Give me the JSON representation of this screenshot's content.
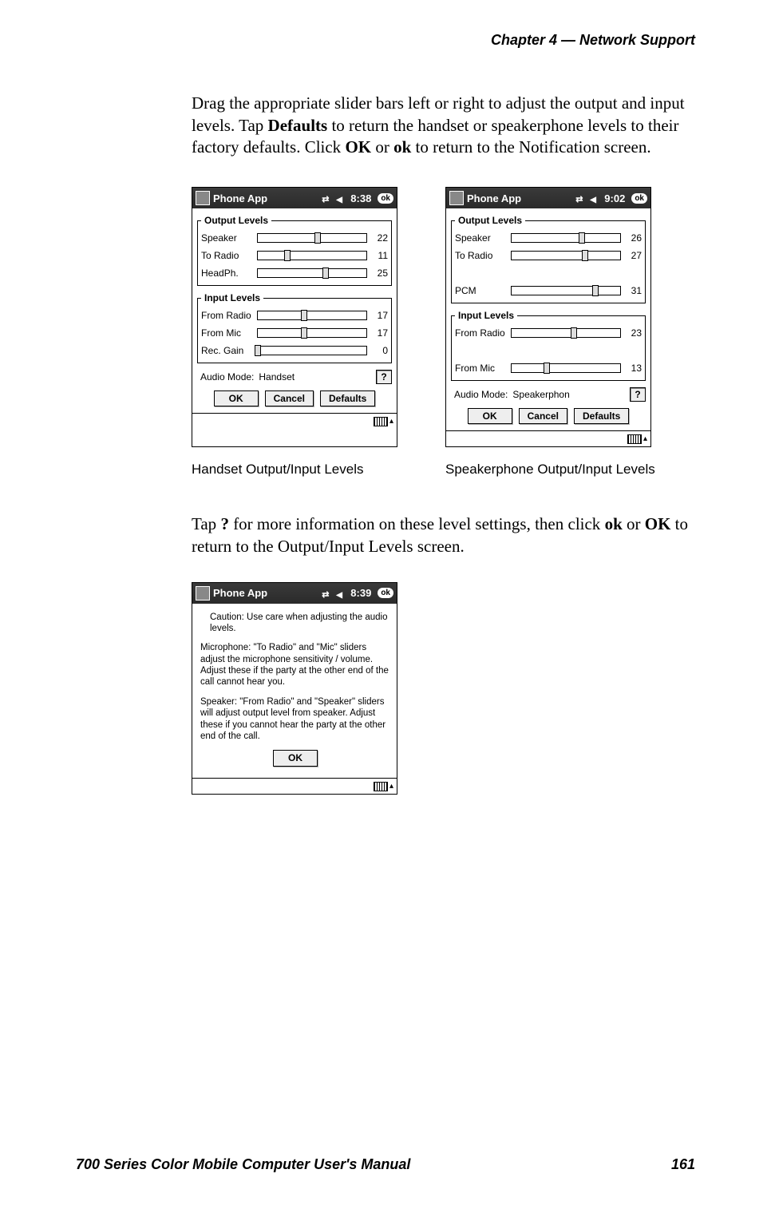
{
  "header": {
    "chapter_label": "Chapter  4  —  Network Support"
  },
  "para1": {
    "pre": "Drag the appropriate slider bars left  or right to adjust the output and input levels. Tap ",
    "b1": "Defaults",
    "mid1": " to return the handset or speakerphone levels to their factory defaults. Click ",
    "b2": "OK",
    "mid2": " or ",
    "b3": "ok",
    "post": " to return to the Notification screen."
  },
  "captions": {
    "left": "Handset Output/Input Levels",
    "right": "Speakerphone Output/Input Levels"
  },
  "para2": {
    "pre": "Tap ",
    "b1": "?",
    "mid1": " for more information on these level settings, then click ",
    "b2": "ok",
    "mid2": " or ",
    "b3": "OK",
    "post": " to return to the Output/Input Levels screen."
  },
  "footer": {
    "manual_title": "700 Series Color Mobile Computer User's Manual",
    "page_number": "161"
  },
  "common": {
    "title_app": "Phone App",
    "ok_pill": "ok",
    "output_legend": "Output Levels",
    "input_legend": "Input Levels",
    "audio_mode_label": "Audio Mode:",
    "help_symbol": "?",
    "btn_ok": "OK",
    "btn_cancel": "Cancel",
    "btn_defaults": "Defaults"
  },
  "handset": {
    "time": "8:38",
    "output": [
      {
        "label": "Speaker",
        "value": 22,
        "max": 40
      },
      {
        "label": "To Radio",
        "value": 11,
        "max": 40
      },
      {
        "label": "HeadPh.",
        "value": 25,
        "max": 40
      }
    ],
    "input": [
      {
        "label": "From Radio",
        "value": 17,
        "max": 40
      },
      {
        "label": "From Mic",
        "value": 17,
        "max": 40
      },
      {
        "label": "Rec. Gain",
        "value": 0,
        "max": 40
      }
    ],
    "mode_value": "Handset"
  },
  "speakerphone": {
    "time": "9:02",
    "output": [
      {
        "label": "Speaker",
        "value": 26,
        "max": 40
      },
      {
        "label": "To Radio",
        "value": 27,
        "max": 40
      },
      {
        "label": "",
        "value": null,
        "max": 40
      },
      {
        "label": "PCM",
        "value": 31,
        "max": 40
      }
    ],
    "input": [
      {
        "label": "From Radio",
        "value": 23,
        "max": 40
      },
      {
        "label": "",
        "value": null,
        "max": 40
      },
      {
        "label": "From Mic",
        "value": 13,
        "max": 40
      }
    ],
    "mode_value": "Speakerphon"
  },
  "help": {
    "time": "8:39",
    "p1": "Caution:  Use care when adjusting the audio levels.",
    "p2": "Microphone:  \"To Radio\" and \"Mic\" sliders adjust the microphone sensitivity / volume.  Adjust these if the party at the other end of the call cannot hear you.",
    "p3": "Speaker: \"From Radio\" and \"Speaker\" sliders will adjust output level from speaker.  Adjust these if you cannot hear the party at the other end of the call.",
    "ok": "OK"
  }
}
